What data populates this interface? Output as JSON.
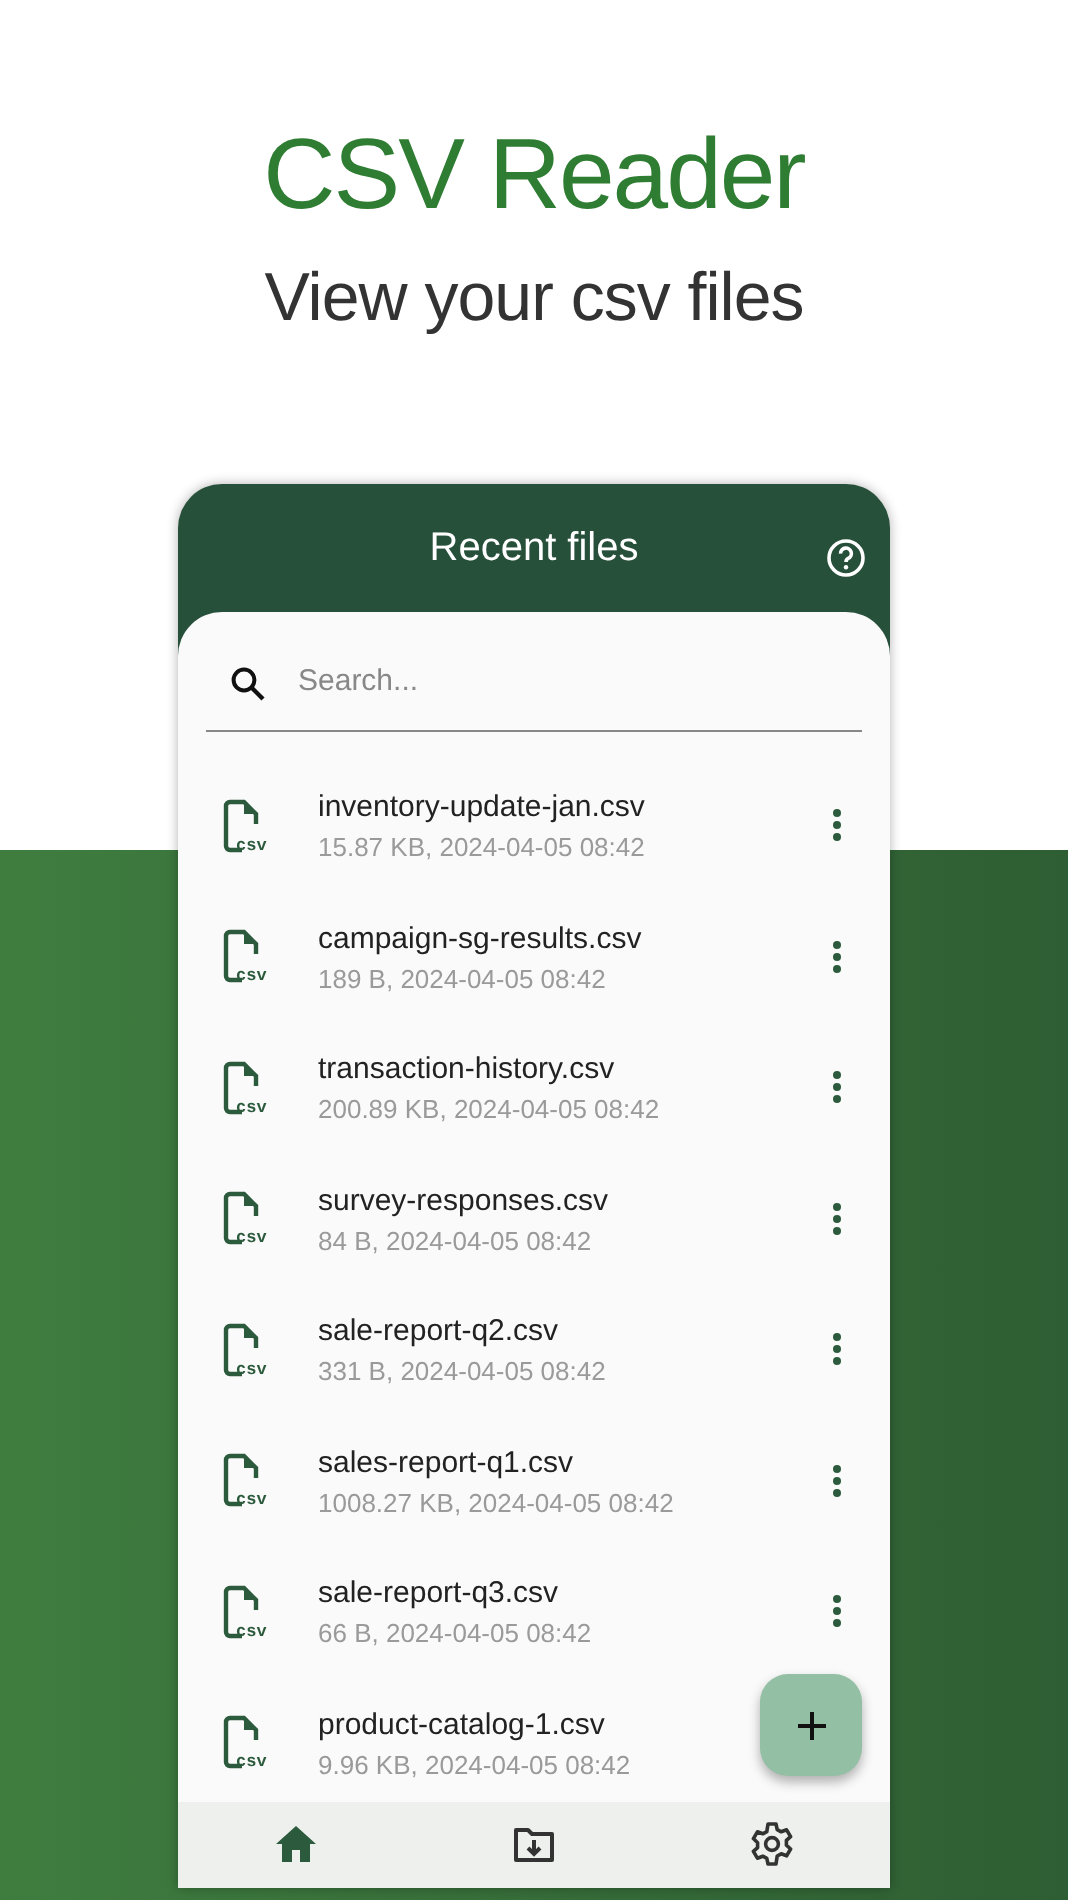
{
  "hero": {
    "title": "CSV Reader",
    "subtitle": "View your csv files"
  },
  "card": {
    "title": "Recent files"
  },
  "search": {
    "placeholder": "Search..."
  },
  "files": [
    {
      "name": "inventory-update-jan.csv",
      "meta": "15.87 KB, 2024-04-05 08:42",
      "badge": "csv"
    },
    {
      "name": "campaign-sg-results.csv",
      "meta": "189 B, 2024-04-05 08:42",
      "badge": "csv"
    },
    {
      "name": "transaction-history.csv",
      "meta": "200.89 KB, 2024-04-05 08:42",
      "badge": "csv"
    },
    {
      "name": "survey-responses.csv",
      "meta": "84 B, 2024-04-05 08:42",
      "badge": "csv"
    },
    {
      "name": "sale-report-q2.csv",
      "meta": "331 B, 2024-04-05 08:42",
      "badge": "csv"
    },
    {
      "name": "sales-report-q1.csv",
      "meta": "1008.27 KB, 2024-04-05 08:42",
      "badge": "csv"
    },
    {
      "name": "sale-report-q3.csv",
      "meta": "66 B, 2024-04-05 08:42",
      "badge": "csv"
    },
    {
      "name": "product-catalog-1.csv",
      "meta": "9.96 KB, 2024-04-05 08:42",
      "badge": "csv"
    }
  ],
  "nav": [
    {
      "kind": "home",
      "selected": true
    },
    {
      "kind": "import",
      "selected": false
    },
    {
      "kind": "settings",
      "selected": false
    }
  ]
}
